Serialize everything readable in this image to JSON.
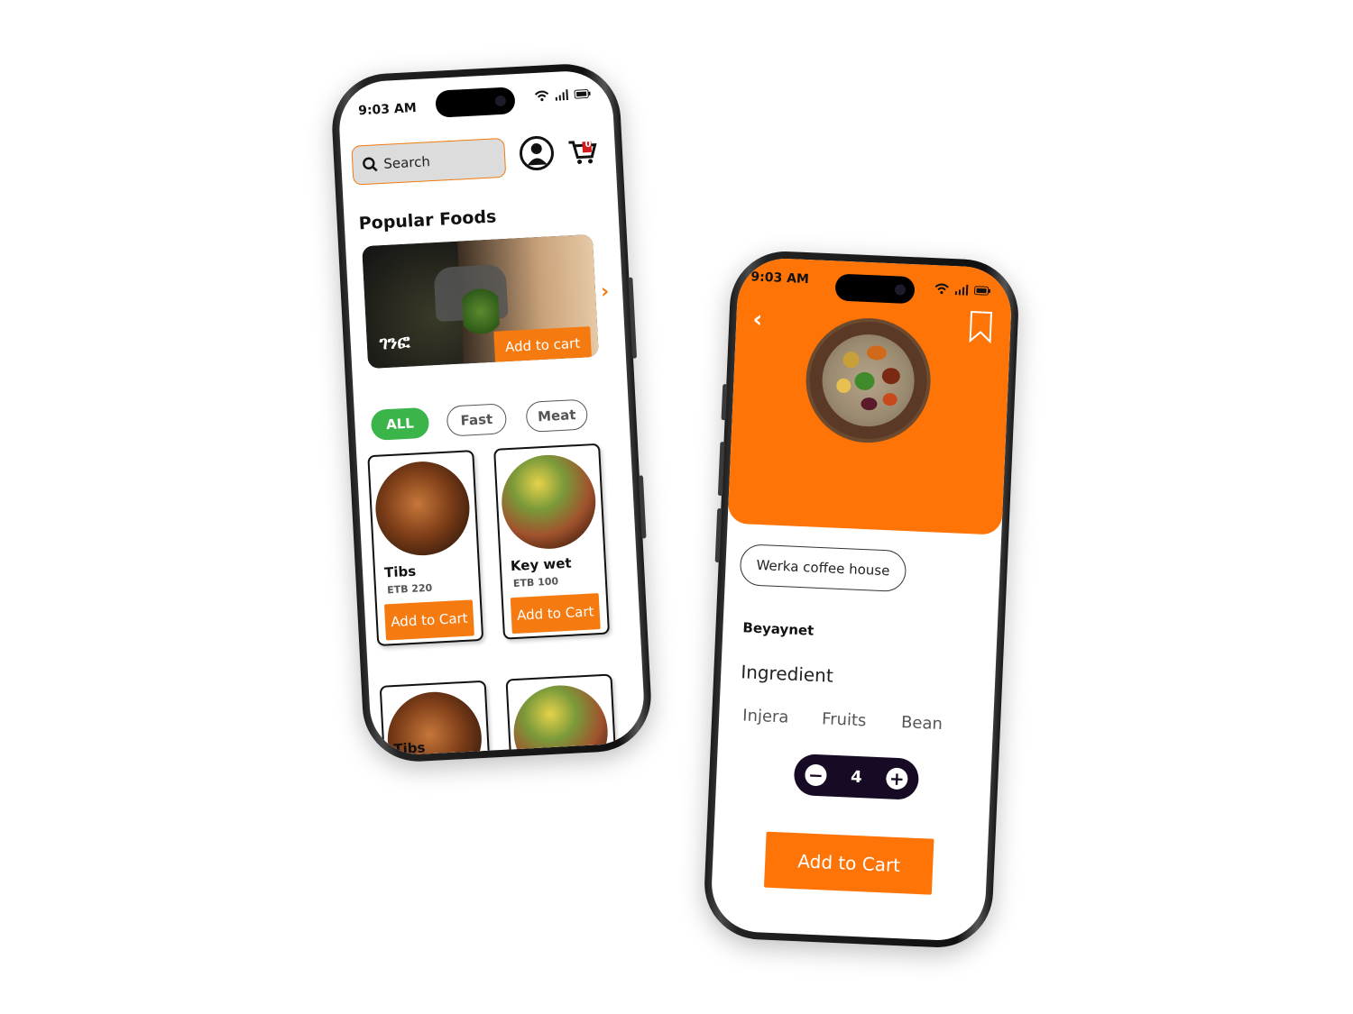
{
  "status_bar": {
    "time": "9:03 AM"
  },
  "home": {
    "search_placeholder": "Search",
    "cart_count": "0",
    "section_title": "Popular Foods",
    "banner": {
      "overlay_text": "ገንፎ",
      "button": "Add to cart"
    },
    "filters": [
      "ALL",
      "Fast",
      "Meat"
    ],
    "foods": [
      {
        "name": "Tibs",
        "price": "ETB 220",
        "button": "Add to Cart"
      },
      {
        "name": "Key wet",
        "price": "ETB 100",
        "button": "Add to Cart"
      },
      {
        "name": "Tibs",
        "price": "",
        "button": ""
      },
      {
        "name": "",
        "price": "",
        "button": ""
      }
    ]
  },
  "detail": {
    "vendor": "Werka coffee house",
    "dish_name": "Beyaynet",
    "ingredient_heading": "Ingredient",
    "ingredients": [
      "Injera",
      "Fruits",
      "Bean"
    ],
    "quantity": "4",
    "minus": "−",
    "plus": "+",
    "add_button": "Add to Cart"
  },
  "colors": {
    "accent": "#ff7407",
    "active_chip": "#3bb54a",
    "stepper_bg": "#160a24"
  }
}
